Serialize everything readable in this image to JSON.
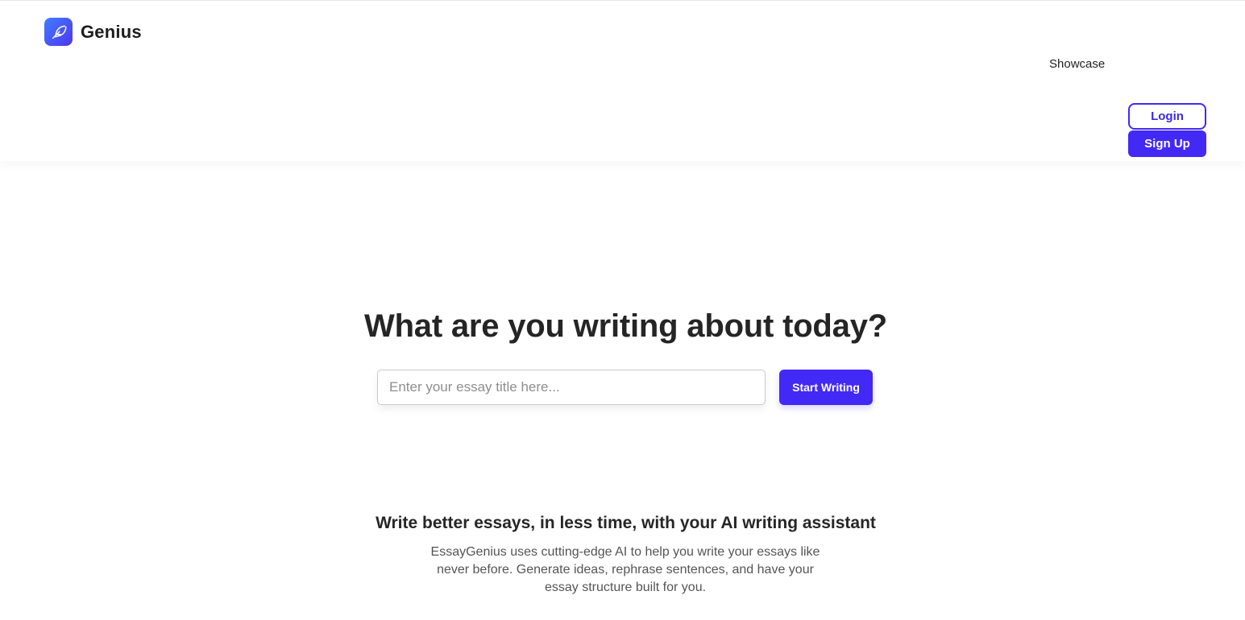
{
  "header": {
    "logo_text": "Genius",
    "logo_icon": "feather-icon",
    "nav": {
      "showcase": "Showcase"
    },
    "login_label": "Login",
    "signup_label": "Sign Up"
  },
  "hero": {
    "title": "What are you writing about today?",
    "input_placeholder": "Enter your essay title here...",
    "input_value": "",
    "start_button_label": "Start Writing"
  },
  "features": {
    "title": "Write better essays, in less time, with your AI writing assistant",
    "description": "EssayGenius uses cutting-edge AI to help you write your essays like never before. Generate ideas, rephrase sentences, and have your essay structure built for you."
  },
  "colors": {
    "accent": "#4329f5",
    "logo_gradient_start": "#3f7dff",
    "logo_gradient_end": "#4f35f0"
  }
}
